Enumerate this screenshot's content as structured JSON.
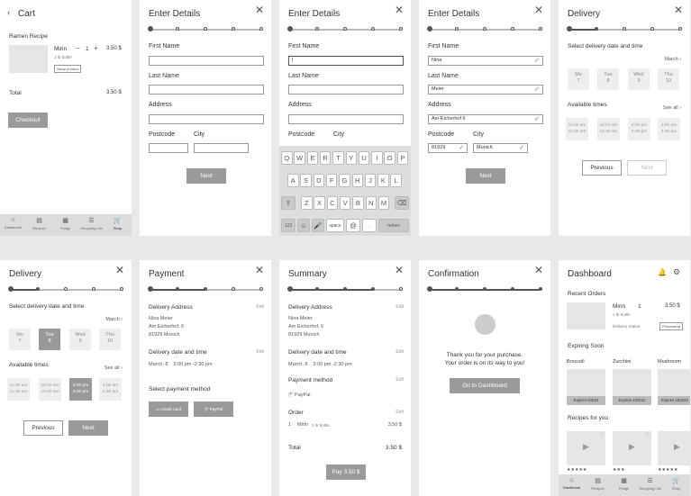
{
  "cart": {
    "title": "Cart",
    "recipe": "Ramen Recipe",
    "item_name": "Mirin",
    "item_sub": "1 ltr bottle",
    "qty": "1",
    "price": "3.50 $",
    "swap_label": "Swap product",
    "total_label": "Total",
    "total_value": "3.50 $",
    "checkout_label": "Checkout"
  },
  "nav": {
    "labels": [
      "Dashboard",
      "Recipes",
      "Fridge",
      "Shopping List",
      "Shop"
    ]
  },
  "details": {
    "title": "Enter Details",
    "first_name": "First Name",
    "last_name": "Last Name",
    "address": "Address",
    "postcode": "Postcode",
    "city": "City",
    "next": "Next",
    "first_value": "Nina",
    "last_value": "Meier",
    "address_value": "Am Eicherhof 6",
    "postcode_value": "81929",
    "city_value": "Munich"
  },
  "keyboard": {
    "row1": [
      "Q",
      "W",
      "E",
      "R",
      "T",
      "Y",
      "U",
      "I",
      "O",
      "P"
    ],
    "row2": [
      "A",
      "S",
      "D",
      "F",
      "G",
      "H",
      "J",
      "K",
      "L"
    ],
    "row3": [
      "Z",
      "X",
      "C",
      "V",
      "B",
      "N",
      "M"
    ],
    "k123": "123",
    "space": "space",
    "at": "@",
    "dot": ".",
    "return": "return"
  },
  "delivery": {
    "title": "Delivery",
    "select_label": "Select delivery date and time",
    "month": "March",
    "days": [
      {
        "d": "Mo",
        "n": "7"
      },
      {
        "d": "Tue",
        "n": "8"
      },
      {
        "d": "Wed",
        "n": "9"
      },
      {
        "d": "Thu",
        "n": "10"
      }
    ],
    "available": "Available times",
    "see_all": "See all",
    "times": [
      "11:00 am 11:30 am",
      "12:00 am 12:30 am",
      "2:00 pm 2:30 pm",
      "4:00 am 4:30 am"
    ],
    "previous": "Previous",
    "next": "Next"
  },
  "payment": {
    "title": "Payment",
    "delivery_address": "Delivery Address",
    "edit": "Edit",
    "addr1": "Nina Meier",
    "addr2": "Am Eicherhof, 6",
    "addr3": "81929 Munich",
    "date_time_label": "Delivery date and time",
    "date_time_value": "March, 8    2:00 pm -2:30 pm",
    "select_method": "Select payment method",
    "credit_card": "Credit Card",
    "paypal": "PayPal"
  },
  "summary": {
    "title": "Summary",
    "payment_method": "Payment method",
    "paypal": "PayPal",
    "order": "Order",
    "order_qty": "1",
    "order_item": "Mirin",
    "order_item_sub": "1 ltr bottle",
    "order_price": "3.50 $",
    "total": "Total",
    "total_value": "3.50 $",
    "pay": "Pay 3.50 $"
  },
  "confirmation": {
    "title": "Confirmation",
    "line1": "Thank you for your purchase.",
    "line2": "Your order is on its way to you!",
    "button": "Go to Dashboard"
  },
  "dashboard": {
    "title": "Dashboard",
    "recent_orders": "Recent Orders",
    "order_item": "Mirin",
    "order_qty": "1",
    "order_price": "3.50 $",
    "order_sub": "1 ltr bottle",
    "status_label": "Delivery Status",
    "status_value": "Processing",
    "expiring": "Expiring Soon",
    "expiring_items": [
      {
        "name": "Broccoli",
        "exp": "Expires 5/3/22"
      },
      {
        "name": "Zucchini",
        "exp": "Expires 12/3/22"
      },
      {
        "name": "Mushroom",
        "exp": "Expires 15/3/22"
      }
    ],
    "recipes": "Recipes for you",
    "ratings": [
      "★★★★★",
      "★★★",
      "★★★★★"
    ]
  },
  "icons": {
    "back": "back-arrow-icon",
    "close": "close-icon",
    "bell": "bell-icon",
    "gear": "gear-icon"
  }
}
